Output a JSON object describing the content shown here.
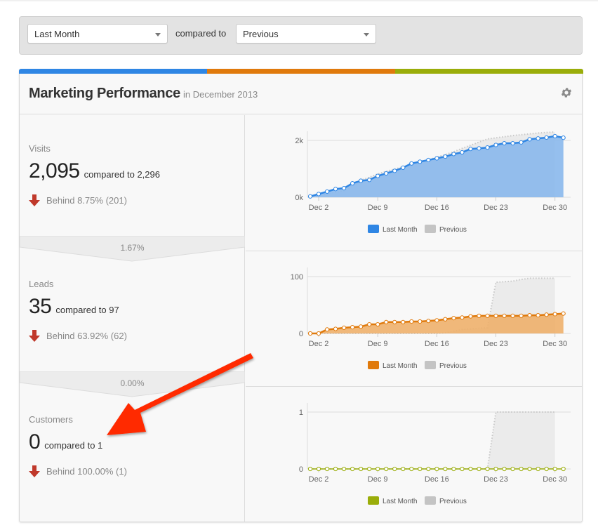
{
  "filters": {
    "period": {
      "selected": "Last Month"
    },
    "compared_to_label": "compared to",
    "comparison": {
      "selected": "Previous"
    }
  },
  "card": {
    "title": "Marketing Performance",
    "subtitle": "in December 2013",
    "color_bar": [
      "#2f86e4",
      "#e07a0c",
      "#9aad0a"
    ],
    "settings_icon": "gear-icon"
  },
  "metrics": [
    {
      "name": "Visits",
      "value": "2,095",
      "compare": "compared to 2,296",
      "delta": "Behind 8.75% (201)",
      "direction": "down"
    },
    {
      "name": "Leads",
      "value": "35",
      "compare": "compared to 97",
      "delta": "Behind 63.92% (62)",
      "direction": "down"
    },
    {
      "name": "Customers",
      "value": "0",
      "compare": "compared to 1",
      "delta": "Behind 100.00% (1)",
      "direction": "down"
    }
  ],
  "conversion_rates": [
    "1.67%",
    "0.00%"
  ],
  "legend": {
    "current": "Last Month",
    "previous": "Previous"
  },
  "chart_data": [
    {
      "type": "area",
      "title": "Visits",
      "x_ticks": [
        "Dec 2",
        "Dec 9",
        "Dec 16",
        "Dec 23",
        "Dec 30"
      ],
      "y_ticks": [
        "0k",
        "2k"
      ],
      "ylim": [
        0,
        2000
      ],
      "color": "#2f86e4",
      "fill": "#8ab8ec",
      "x": [
        1,
        2,
        3,
        4,
        5,
        6,
        7,
        8,
        9,
        10,
        11,
        12,
        13,
        14,
        15,
        16,
        17,
        18,
        19,
        20,
        21,
        22,
        23,
        24,
        25,
        26,
        27,
        28,
        29,
        30,
        31
      ],
      "series": [
        {
          "name": "Last Month",
          "values": [
            30,
            115,
            200,
            290,
            320,
            490,
            580,
            610,
            750,
            840,
            930,
            1040,
            1190,
            1250,
            1310,
            1370,
            1430,
            1520,
            1580,
            1700,
            1720,
            1750,
            1840,
            1900,
            1900,
            1930,
            2040,
            2070,
            2100,
            2150,
            2095
          ]
        },
        {
          "name": "Previous",
          "values": [
            0,
            60,
            120,
            180,
            230,
            400,
            600,
            700,
            820,
            910,
            990,
            1070,
            1170,
            1240,
            1310,
            1410,
            1500,
            1600,
            1720,
            1830,
            1940,
            2050,
            2090,
            2130,
            2170,
            2200,
            2230,
            2260,
            2280,
            2296
          ]
        }
      ]
    },
    {
      "type": "area",
      "title": "Leads",
      "x_ticks": [
        "Dec 2",
        "Dec 9",
        "Dec 16",
        "Dec 23",
        "Dec 30"
      ],
      "y_ticks": [
        "0",
        "100"
      ],
      "ylim": [
        0,
        100
      ],
      "color": "#e07a0c",
      "fill": "#eeb06c",
      "x": [
        1,
        2,
        3,
        4,
        5,
        6,
        7,
        8,
        9,
        10,
        11,
        12,
        13,
        14,
        15,
        16,
        17,
        18,
        19,
        20,
        21,
        22,
        23,
        24,
        25,
        26,
        27,
        28,
        29,
        30,
        31
      ],
      "series": [
        {
          "name": "Last Month",
          "values": [
            0,
            0,
            7,
            8,
            10,
            11,
            12,
            16,
            16,
            20,
            20,
            20,
            21,
            21,
            22,
            23,
            25,
            27,
            28,
            30,
            31,
            31,
            31,
            31,
            31,
            31,
            32,
            32,
            33,
            34,
            35
          ]
        },
        {
          "name": "Previous",
          "values": [
            0,
            0,
            0,
            0,
            0,
            0,
            0,
            0,
            0,
            0,
            0,
            0,
            0,
            0,
            0,
            0,
            1,
            4,
            7,
            8,
            9,
            10,
            90,
            91,
            92,
            95,
            97,
            97,
            97,
            97
          ]
        }
      ]
    },
    {
      "type": "area",
      "title": "Customers",
      "x_ticks": [
        "Dec 2",
        "Dec 9",
        "Dec 16",
        "Dec 23",
        "Dec 30"
      ],
      "y_ticks": [
        "0",
        "1"
      ],
      "ylim": [
        0,
        1
      ],
      "color": "#9aad0a",
      "fill": "#c5d06a",
      "x": [
        1,
        2,
        3,
        4,
        5,
        6,
        7,
        8,
        9,
        10,
        11,
        12,
        13,
        14,
        15,
        16,
        17,
        18,
        19,
        20,
        21,
        22,
        23,
        24,
        25,
        26,
        27,
        28,
        29,
        30,
        31
      ],
      "series": [
        {
          "name": "Last Month",
          "values": [
            0,
            0,
            0,
            0,
            0,
            0,
            0,
            0,
            0,
            0,
            0,
            0,
            0,
            0,
            0,
            0,
            0,
            0,
            0,
            0,
            0,
            0,
            0,
            0,
            0,
            0,
            0,
            0,
            0,
            0,
            0
          ]
        },
        {
          "name": "Previous",
          "values": [
            0,
            0,
            0,
            0,
            0,
            0,
            0,
            0,
            0,
            0,
            0,
            0,
            0,
            0,
            0,
            0,
            0,
            0,
            0,
            0,
            0,
            0,
            1,
            1,
            1,
            1,
            1,
            1,
            1,
            1
          ]
        }
      ]
    }
  ]
}
